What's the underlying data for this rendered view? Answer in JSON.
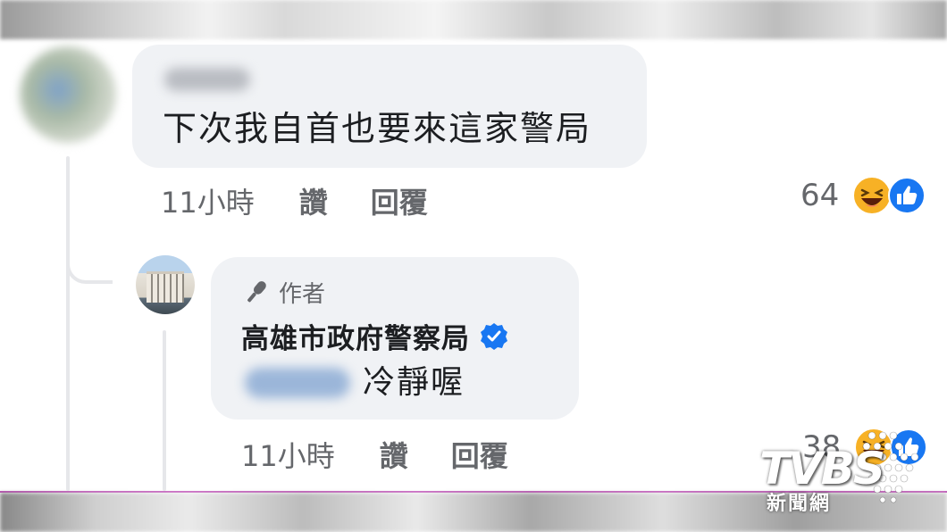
{
  "comment1": {
    "text": "下次我自首也要來這家警局",
    "time": "11小時",
    "like_label": "讚",
    "reply_label": "回覆",
    "reaction_count": "64",
    "reactions": [
      "haha-emoji-icon",
      "like-icon"
    ]
  },
  "reply": {
    "author_badge_label": "作者",
    "author_icon": "microphone-icon",
    "page_name": "高雄市政府警察局",
    "verified_icon": "verified-badge-icon",
    "text": "冷靜喔",
    "time": "11小時",
    "like_label": "讚",
    "reply_label": "回覆",
    "reaction_count": "38",
    "reactions": [
      "haha-emoji-icon",
      "like-icon"
    ]
  },
  "watermark": {
    "logo": "TVBS",
    "subtitle": "新聞網"
  },
  "colors": {
    "bubble": "#f0f2f5",
    "secondary_text": "#65676b",
    "verified_blue": "#1877f2",
    "reaction_yellow": "#f7b125",
    "frame_line": "#c04ab8"
  }
}
